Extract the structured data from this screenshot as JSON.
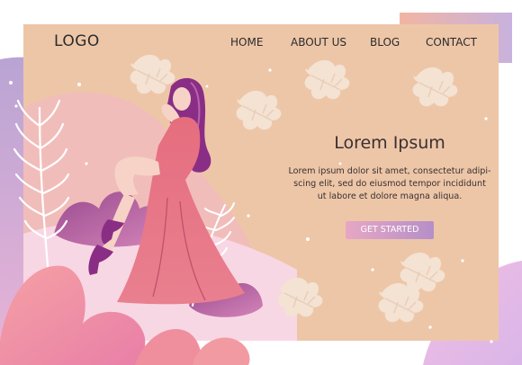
{
  "nav": {
    "logo": "LOGO",
    "items": [
      {
        "label": "HOME"
      },
      {
        "label": "ABOUT US"
      },
      {
        "label": "BLOG"
      },
      {
        "label": "CONTACT"
      }
    ]
  },
  "hero": {
    "title": "Lorem Ipsum",
    "text_lines": [
      "Lorem ipsum dolor sit amet, consectetur adipi-",
      "scing elit, sed do eiusmod tempor incididunt",
      "ut labore et dolore magna aliqua."
    ],
    "cta_label": "GET STARTED"
  },
  "colors": {
    "panel": "#edc6a8",
    "accent_pink": "#e98aa4",
    "accent_purple": "#8a3a88",
    "button_start": "#e7a7c4",
    "button_end": "#b58fc9"
  },
  "icons": [
    "leaf-icon",
    "fern-icon"
  ]
}
